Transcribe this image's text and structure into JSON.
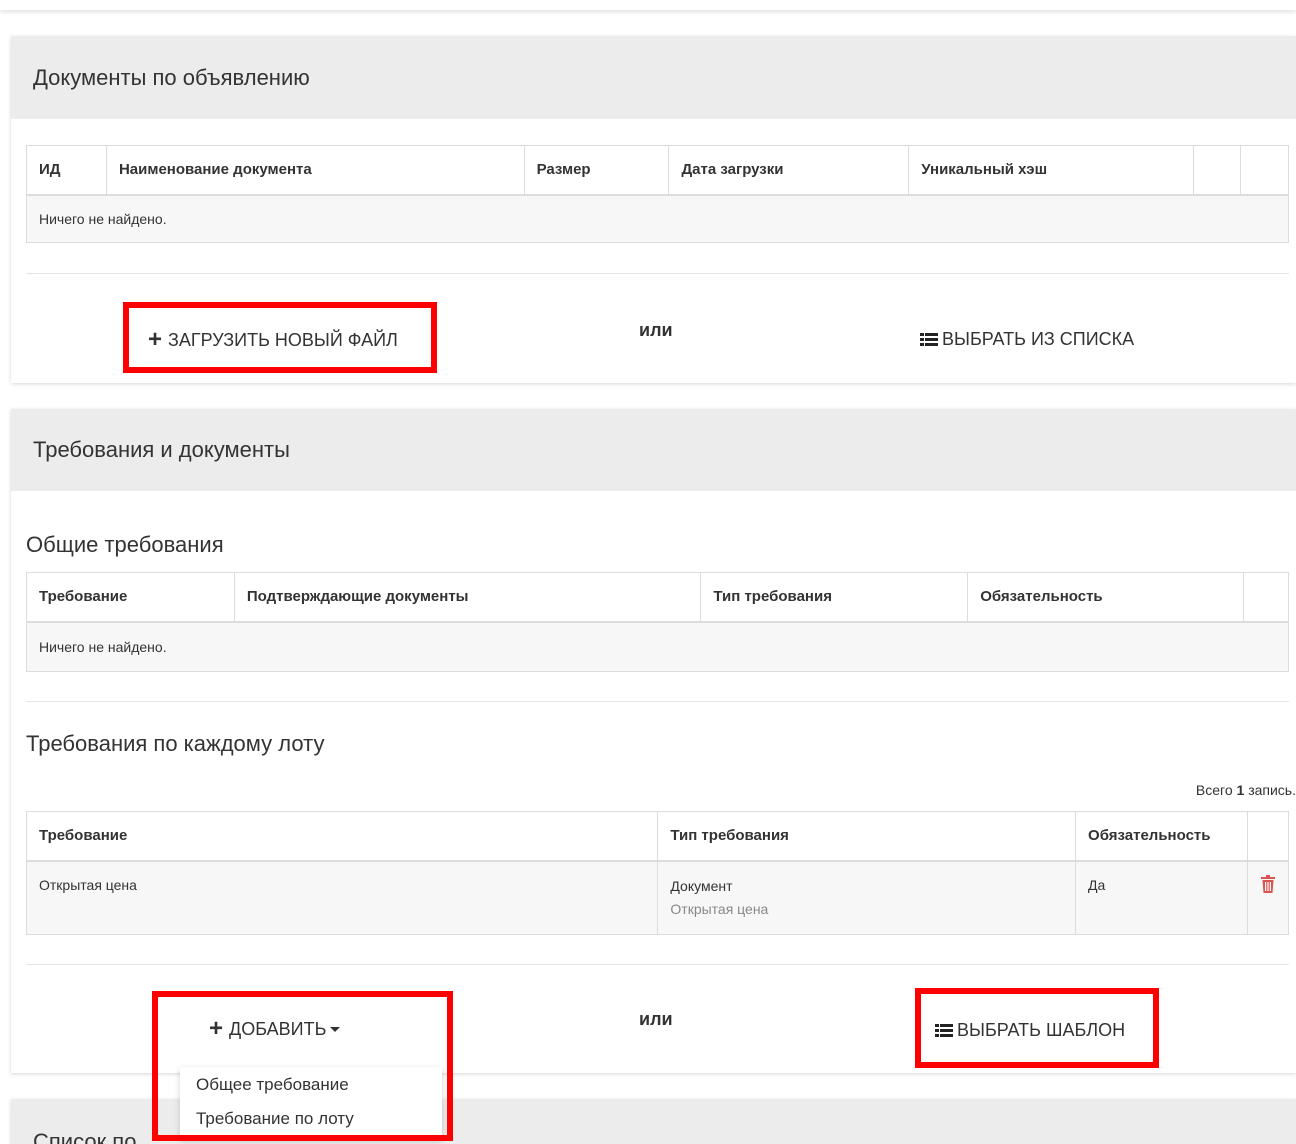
{
  "documents_panel": {
    "title": "Документы по объявлению",
    "columns": [
      "ИД",
      "Наименование документа",
      "Размер",
      "Дата загрузки",
      "Уникальный хэш",
      "",
      ""
    ],
    "empty_text": "Ничего не найдено.",
    "upload_label": "ЗАГРУЗИТЬ НОВЫЙ ФАЙЛ",
    "or_label": "или",
    "choose_label": "ВЫБРАТЬ ИЗ СПИСКА"
  },
  "requirements_panel": {
    "title": "Требования и документы",
    "general": {
      "title": "Общие требования",
      "columns": [
        "Требование",
        "Подтверждающие документы",
        "Тип требования",
        "Обязательность",
        ""
      ],
      "empty_text": "Ничего не найдено."
    },
    "per_lot": {
      "title": "Требования по каждому лоту",
      "total_prefix": "Всего",
      "total_count": "1",
      "total_suffix": "запись.",
      "columns": [
        "Требование",
        "Тип требования",
        "Обязательность",
        ""
      ],
      "rows": [
        {
          "requirement": "Открытая цена",
          "type": "Документ",
          "type_sub": "Открытая цена",
          "mandatory": "Да"
        }
      ]
    },
    "add_label": "ДОБАВИТЬ",
    "or_label": "или",
    "template_label": "ВЫБРАТЬ ШАБЛОН",
    "dropdown_items": [
      "Общее требование",
      "Требование по лоту"
    ]
  },
  "participants_panel": {
    "title": "Список по"
  },
  "colors": {
    "highlight": "#ff0000",
    "panel_header": "#ececec",
    "delete_icon": "#d9534f"
  }
}
